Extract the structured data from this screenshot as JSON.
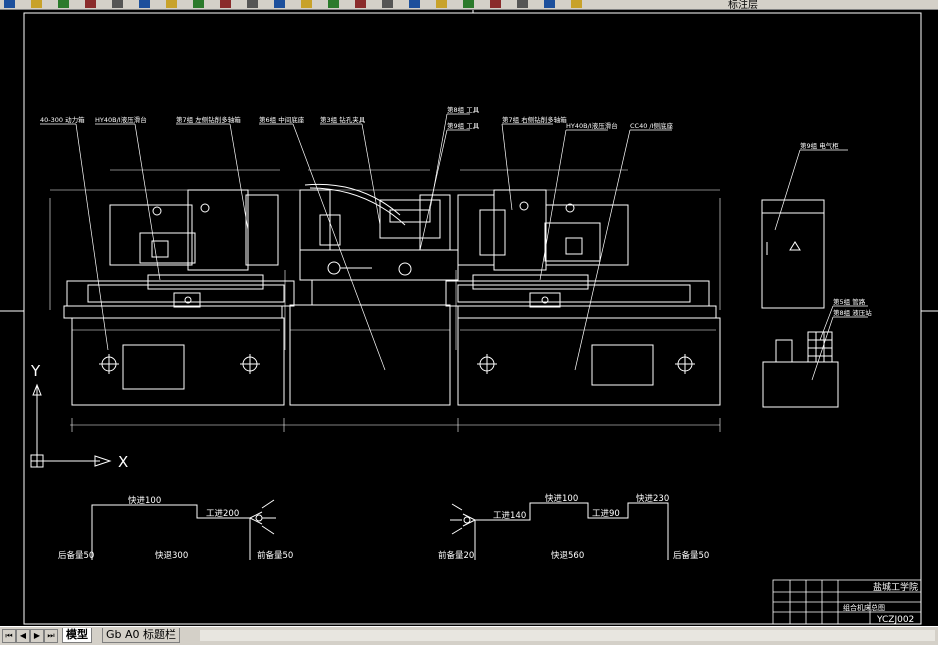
{
  "toolbar": {
    "icons": [
      "new-icon",
      "open-icon",
      "save-icon",
      "print-icon",
      "preview-icon",
      "cut-icon",
      "copy-icon",
      "paste-icon",
      "match-icon",
      "undo-icon",
      "redo-icon",
      "pan-icon",
      "zoom-icon",
      "zoom-window-icon",
      "zoom-prev-icon",
      "properties-icon",
      "designcenter-icon",
      "toolpalette-icon",
      "calc-icon",
      "help-icon",
      "layer-icon",
      "layer-state-icon"
    ],
    "layer_text": "标注层"
  },
  "ucs": {
    "x_label": "X",
    "y_label": "Y"
  },
  "labels": {
    "top": [
      "40-300 动力箱",
      "HY40B/I液压滑台",
      "第7组 左侧钻削多轴箱",
      "第6组 中间底座",
      "第3组 钻孔夹具",
      "第8组 工具",
      "第9组 工具",
      "第7组 右侧钻削多轴箱",
      "HY40B/I液压滑台",
      "CC40 /I侧底座"
    ],
    "right": [
      "第9组 电气柜",
      "第5组 管路",
      "第8组 液压站"
    ]
  },
  "cycle_left": {
    "rapid_in": "快进100",
    "work": "工进200",
    "rapid_back": "快退300",
    "front_stop": "前备量50",
    "rear_stop": "后备量50"
  },
  "cycle_right": {
    "work1": "工进140",
    "rapid": "快进100",
    "work2": "工进90",
    "rapid_in": "快进230",
    "rapid_back": "快退560",
    "front_stop": "前备量20",
    "rear_stop": "后备量50"
  },
  "title_block": {
    "school": "盐城工学院",
    "title": "组合机床总图",
    "code": "YCZJ002"
  },
  "tabs": {
    "model": "模型",
    "layout1": "Gb A0 标题栏"
  },
  "nav": {
    "first": "⏮",
    "prev": "◀",
    "next": "▶",
    "last": "⏭"
  },
  "colors": {
    "background": "#000000",
    "lines": "#ffffff",
    "chrome": "#d4d0c8"
  }
}
